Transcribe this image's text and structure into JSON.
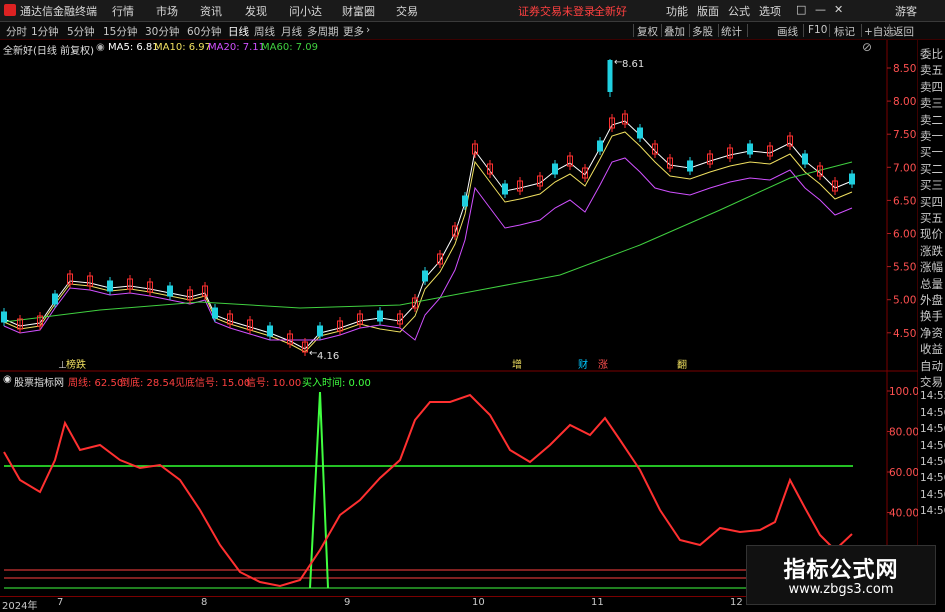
{
  "app": {
    "title": "通达信金融终端",
    "status_text": "证券交易未登录",
    "stock_name": "全新好",
    "right_menu": [
      "功能",
      "版面",
      "公式",
      "选项",
      "□",
      "—",
      "✕",
      "游客"
    ]
  },
  "menu": {
    "items": [
      "行情",
      "市场",
      "资讯",
      "发现",
      "问小达",
      "财富圈",
      "交易"
    ]
  },
  "toolbar": {
    "periods": [
      "分时",
      "1分钟",
      "5分钟",
      "15分钟",
      "30分钟",
      "60分钟",
      "日线",
      "周线",
      "月线",
      "多周期",
      "更多"
    ],
    "right": [
      "复权",
      "叠加",
      "多股",
      "统计",
      "画线",
      "F10",
      "标记",
      "+自选",
      "返回"
    ]
  },
  "price_panel": {
    "title": "全新好(日线 前复权)",
    "ma": [
      {
        "label": "MA5: 6.81",
        "color": "#ffffff"
      },
      {
        "label": "MA10: 6.97",
        "color": "#f0e060"
      },
      {
        "label": "MA20: 7.11",
        "color": "#d050ff"
      },
      {
        "label": "MA60: 7.09",
        "color": "#40d040"
      }
    ],
    "high_label": "8.61",
    "low_label": "4.16",
    "axis": [
      "8.50",
      "8.00",
      "7.50",
      "7.00",
      "6.50",
      "6.00",
      "5.50",
      "5.00",
      "4.50"
    ],
    "markers": [
      {
        "text": "⊥",
        "color": "#d0d0d0"
      },
      {
        "text": "榜跌",
        "color": "#f0e060"
      },
      {
        "text": "增",
        "color": "#f0e060"
      },
      {
        "text": "财",
        "color": "#00c8ff"
      },
      {
        "text": "涨",
        "color": "#ff5050"
      },
      {
        "text": "翻",
        "color": "#f0e060"
      }
    ]
  },
  "indicator_panel": {
    "title": "股票指标网",
    "values": [
      {
        "label": "周线: 62.50",
        "color": "#ff4040"
      },
      {
        "label": "倒底: 28.54",
        "color": "#ff4040"
      },
      {
        "label": "见底信号: 15.00",
        "color": "#ff4040"
      },
      {
        "label": "信号: 10.00",
        "color": "#ff4040"
      },
      {
        "label": "买入时间: 0.00",
        "color": "#40ff40"
      }
    ],
    "axis": [
      "100.0",
      "80.00",
      "60.00",
      "40.00"
    ]
  },
  "right_column": {
    "items": [
      "委比",
      "卖五",
      "卖四",
      "卖三",
      "卖二",
      "卖一",
      "买一",
      "买二",
      "买三",
      "买四",
      "买五",
      "现价",
      "涨跌",
      "涨幅",
      "总量",
      "外盘",
      "换手",
      "净资",
      "收益",
      "自动",
      "交易",
      "14:55",
      "14:56",
      "14:56",
      "14:56",
      "14:56",
      "14:56",
      "14:56",
      "14:56"
    ]
  },
  "dates": [
    "2024年",
    "7",
    "8",
    "9",
    "10",
    "11",
    "12"
  ],
  "watermark": {
    "title": "指标公式网",
    "url": "www.zbgs3.com"
  }
}
